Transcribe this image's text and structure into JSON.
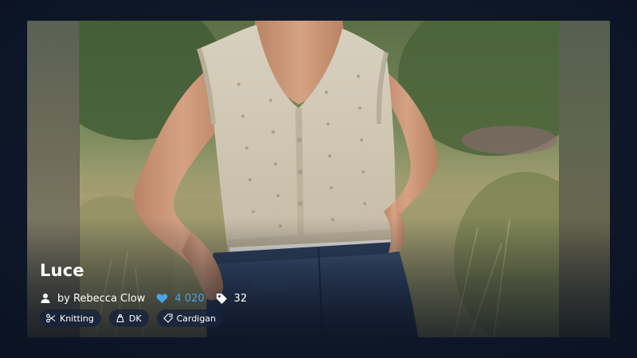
{
  "pattern": {
    "title": "Luce",
    "author_label": "by Rebecca Clow",
    "likes": "4 020",
    "projects": "32",
    "tags": [
      {
        "label": "Knitting",
        "icon": "scissors-icon"
      },
      {
        "label": "DK",
        "icon": "yarn-weight-icon"
      },
      {
        "label": "Cardigan",
        "icon": "tag-icon"
      }
    ]
  },
  "colors": {
    "background": "#0f1a2c",
    "likes_accent": "#4aa3e6",
    "chip_background": "#14223c"
  },
  "icons": {
    "author": "user-icon",
    "likes": "heart-icon",
    "projects": "tag-icon"
  }
}
